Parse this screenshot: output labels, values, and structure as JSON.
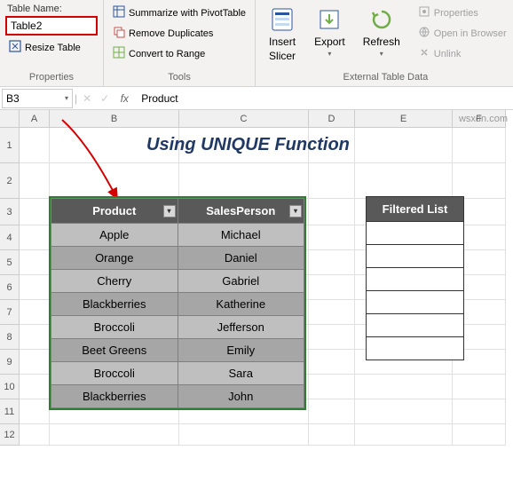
{
  "ribbon": {
    "tablename_label": "Table Name:",
    "tablename_value": "Table2",
    "resize_table": "Resize Table",
    "properties_label": "Properties",
    "summarize": "Summarize with PivotTable",
    "remove_dup": "Remove Duplicates",
    "convert_range": "Convert to Range",
    "tools_label": "Tools",
    "insert_slicer_l1": "Insert",
    "insert_slicer_l2": "Slicer",
    "export": "Export",
    "refresh": "Refresh",
    "props": "Properties",
    "open_browser": "Open in Browser",
    "unlink": "Unlink",
    "ext_label": "External Table Data"
  },
  "namebox": "B3",
  "fx": "fx",
  "formula": "Product",
  "columns": [
    "A",
    "B",
    "C",
    "D",
    "E",
    "F"
  ],
  "title": "Using UNIQUE Function",
  "table": {
    "headers": [
      "Product",
      "SalesPerson"
    ],
    "rows": [
      [
        "Apple",
        "Michael"
      ],
      [
        "Orange",
        "Daniel"
      ],
      [
        "Cherry",
        "Gabriel"
      ],
      [
        "Blackberries",
        "Katherine"
      ],
      [
        "Broccoli",
        "Jefferson"
      ],
      [
        "Beet Greens",
        "Emily"
      ],
      [
        "Broccoli",
        "Sara"
      ],
      [
        "Blackberries",
        "John"
      ]
    ]
  },
  "filtered_header": "Filtered List",
  "watermark": "wsxdn.com"
}
